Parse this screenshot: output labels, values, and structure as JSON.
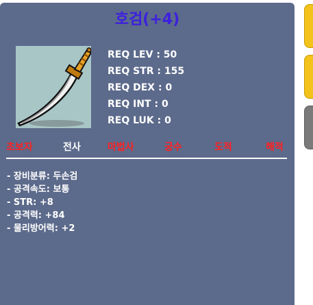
{
  "item": {
    "title": "호검(+4)",
    "icon": "sword-icon"
  },
  "requirements": [
    "REQ LEV : 50",
    "REQ STR : 155",
    "REQ DEX : 0",
    "REQ INT : 0",
    "REQ LUK : 0"
  ],
  "jobs": [
    {
      "label": "초보자",
      "enabled": false
    },
    {
      "label": "전사",
      "enabled": true
    },
    {
      "label": "마법사",
      "enabled": false
    },
    {
      "label": "궁수",
      "enabled": false
    },
    {
      "label": "도적",
      "enabled": false
    },
    {
      "label": "해적",
      "enabled": false
    }
  ],
  "stats": [
    "- 장비분류: 두손검",
    "- 공격속도: 보통",
    "- STR: +8",
    "- 공격력: +84",
    "- 물리방어력: +2"
  ],
  "colors": {
    "panel": "#5c6a8b",
    "title": "#3d1fe0",
    "job_disabled": "#ff2020",
    "job_enabled": "#ffffff",
    "tab_yellow": "#f3c21b",
    "tab_gray": "#7a7a7a"
  }
}
